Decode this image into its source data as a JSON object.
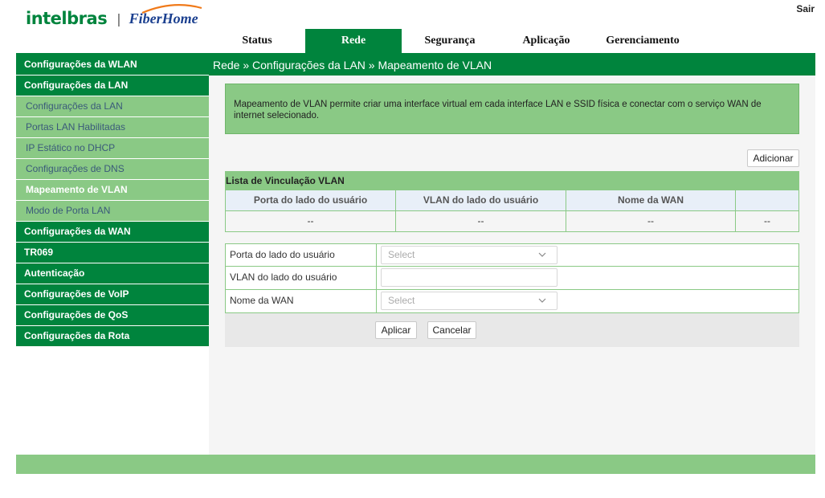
{
  "header": {
    "logo_left": "intelbras",
    "logo_sep": "|",
    "logo_right": "FiberHome",
    "logout": "Sair"
  },
  "topnav": [
    {
      "label": "Status"
    },
    {
      "label": "Rede"
    },
    {
      "label": "Segurança"
    },
    {
      "label": "Aplicação"
    },
    {
      "label": "Gerenciamento"
    }
  ],
  "sidebar": {
    "items": [
      {
        "label": "Configurações da WLAN"
      },
      {
        "label": "Configurações da LAN"
      },
      {
        "label": "Configurações da LAN"
      },
      {
        "label": "Portas LAN Habilitadas"
      },
      {
        "label": "IP Estático no DHCP"
      },
      {
        "label": "Configurações de DNS"
      },
      {
        "label": "Mapeamento de VLAN"
      },
      {
        "label": "Modo de Porta LAN"
      },
      {
        "label": "Configurações da WAN"
      },
      {
        "label": "TR069"
      },
      {
        "label": "Autenticação"
      },
      {
        "label": "Configurações de VoIP"
      },
      {
        "label": "Configurações de QoS"
      },
      {
        "label": "Configurações da Rota"
      }
    ]
  },
  "breadcrumb": "Rede » Configurações da LAN » Mapeamento de VLAN",
  "info": "Mapeamento de VLAN permite criar uma interface virtual em cada interface LAN e SSID física e conectar com o serviço WAN de internet selecionado.",
  "add_button": "Adicionar",
  "table": {
    "title": "Lista de Vinculação VLAN",
    "headers": [
      "Porta do lado do usuário",
      "VLAN do lado do usuário",
      "Nome da WAN",
      ""
    ],
    "rows": [
      [
        "--",
        "--",
        "--",
        "--"
      ]
    ]
  },
  "form": {
    "port_label": "Porta do lado do usuário",
    "port_value": "Select",
    "vlan_label": "VLAN do lado do usuário",
    "vlan_value": "",
    "wan_label": "Nome da WAN",
    "wan_value": "Select"
  },
  "buttons": {
    "apply": "Aplicar",
    "cancel": "Cancelar"
  },
  "colors": {
    "brand_green": "#00843d",
    "light_green": "#8ac985",
    "header_blue": "#e8eff8"
  }
}
